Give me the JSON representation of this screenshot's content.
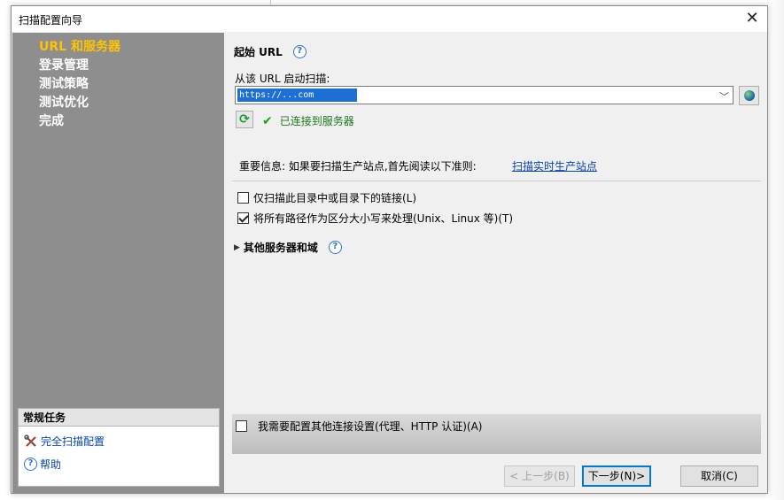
{
  "window": {
    "title": "扫描配置向导"
  },
  "nav": {
    "items": [
      {
        "label": "URL 和服务器",
        "active": true
      },
      {
        "label": "登录管理",
        "active": false
      },
      {
        "label": "测试策略",
        "active": false
      },
      {
        "label": "测试优化",
        "active": false
      },
      {
        "label": "完成",
        "active": false
      }
    ]
  },
  "tasks": {
    "heading": "常规任务",
    "full_config": "完全扫描配置",
    "help": "帮助"
  },
  "main": {
    "section_title": "起始 URL",
    "url_label": "从该 URL 启动扫描:",
    "url_value": "https://...com",
    "status_text": "已连接到服务器",
    "info_text": "重要信息: 如果要扫描生产站点,首先阅读以下准则:",
    "info_link": "扫描实时生产站点",
    "option_links_only": "仅扫描此目录中或目录下的链接(L)",
    "option_case_sensitive": "将所有路径作为区分大小写来处理(Unix、Linux 等)(T)",
    "other_servers": "其他服务器和域",
    "connection_settings": "我需要配置其他连接设置(代理、HTTP 认证)(A)"
  },
  "buttons": {
    "back": "< 上一步(B)",
    "next": "下一步(N)>",
    "cancel": "取消(C)"
  },
  "colors": {
    "sidebar_bg": "#8e8e8e",
    "nav_active": "#ffc300",
    "status_green": "#187a18",
    "link_blue": "#0645ad"
  }
}
